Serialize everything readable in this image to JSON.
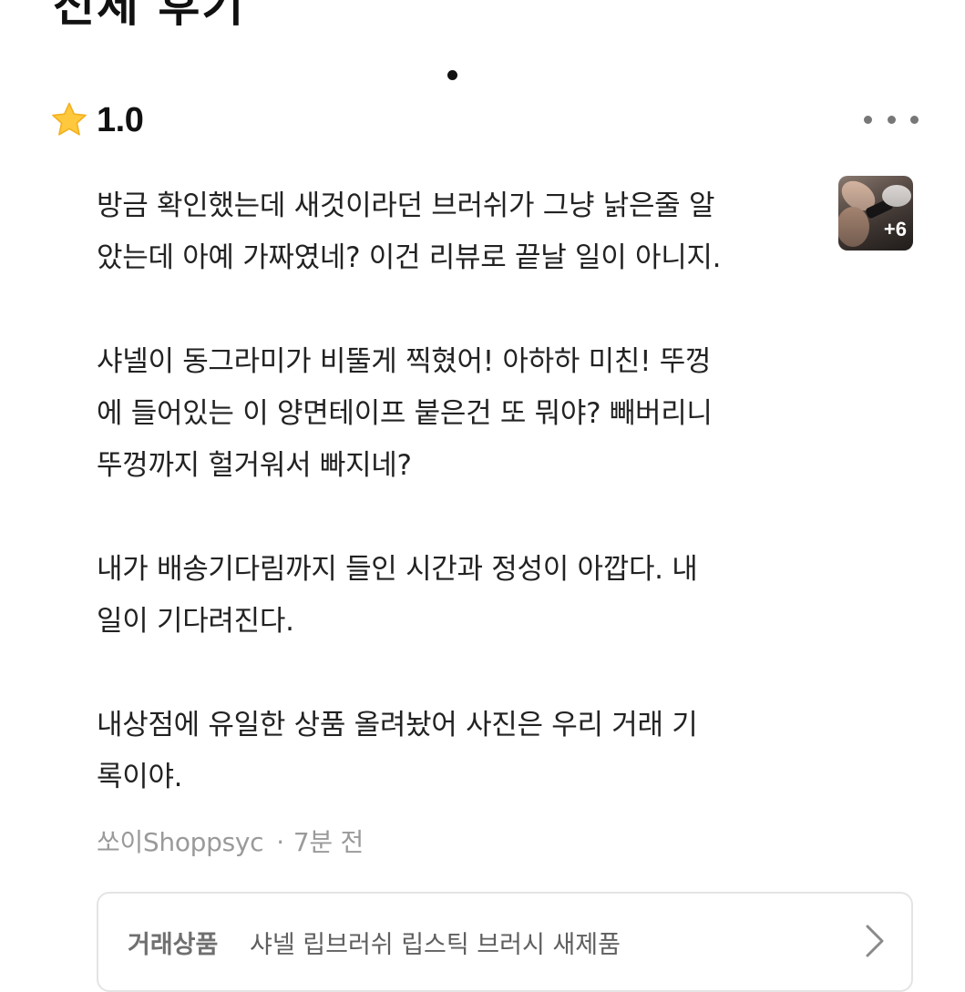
{
  "header": {
    "partial_title": "전체 후기"
  },
  "review": {
    "rating": "1.0",
    "paragraphs": [
      "방금 확인했는데 새것이라던 브러쉬가 그냥 낡은줄 알\n았는데 아예 가짜였네? 이건 리뷰로 끝날 일이 아니지.",
      "샤넬이 동그라미가 비뚤게 찍혔어! 아하하 미친! 뚜껑\n에 들어있는 이 양면테이프 붙은건 또 뭐야? 빼버리니\n뚜껑까지 헐거워서 빠지네?",
      "내가 배송기다림까지 들인 시간과 정성이 아깝다. 내\n일이 기다려진다.",
      "내상점에 유일한 상품 올려놨어 사진은 우리 거래 기\n록이야."
    ],
    "photo_count": "+6",
    "author": "쏘이Shoppsyc",
    "separator": "·",
    "time_ago": "7분 전"
  },
  "product": {
    "label": "거래상품",
    "name": "샤넬 립브러쉬 립스틱 브러시 새제품"
  },
  "colors": {
    "star": "#FFC83D",
    "text": "#222222",
    "meta_text": "#9A9A9A",
    "card_border": "#E4E4E4"
  },
  "icons": {
    "rating": "star-icon",
    "menu": "more-horizontal-icon",
    "card_arrow": "chevron-right-icon"
  }
}
